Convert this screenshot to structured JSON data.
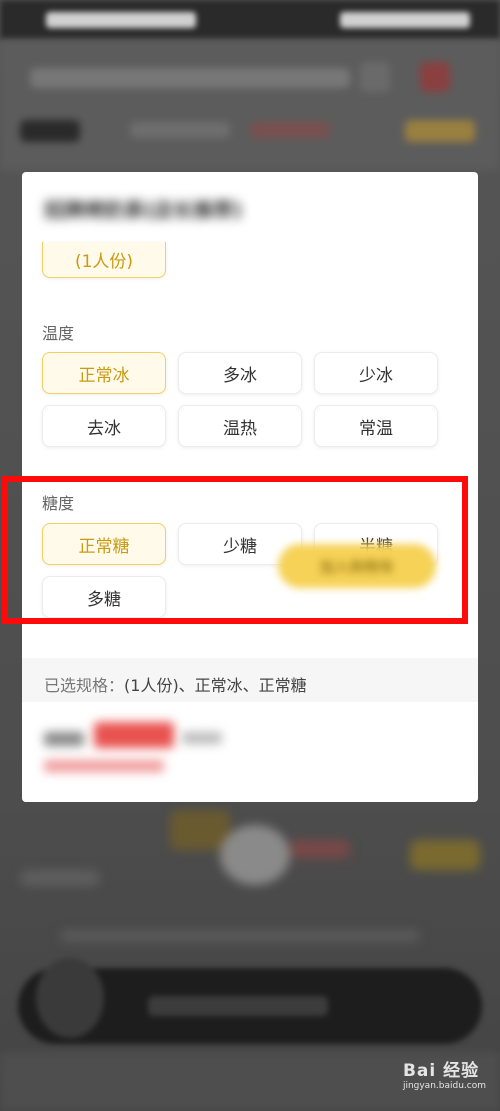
{
  "modal": {
    "title": "招牌烤奶茶(店长推荐)",
    "portion": {
      "selected_label": "(1人份)"
    },
    "temperature": {
      "label": "温度",
      "options": [
        "正常冰",
        "多冰",
        "少冰",
        "去冰",
        "温热",
        "常温"
      ],
      "selected": "正常冰"
    },
    "sweetness": {
      "label": "糖度",
      "options": [
        "正常糖",
        "少糖",
        "半糖",
        "多糖"
      ],
      "selected": "正常糖"
    },
    "summary": {
      "label": "已选规格：",
      "value": "(1人份)、正常冰、正常糖"
    },
    "add_button_label": "加入购物车"
  },
  "watermark": {
    "text": "Bai 经验",
    "sub": "jingyan.baidu.com"
  },
  "colors": {
    "accent": "#f3cf62",
    "selected_text": "#c99a12",
    "selected_bg": "#fffaea",
    "highlight_border": "#ff0a0a",
    "add_button": "#f6d257"
  }
}
